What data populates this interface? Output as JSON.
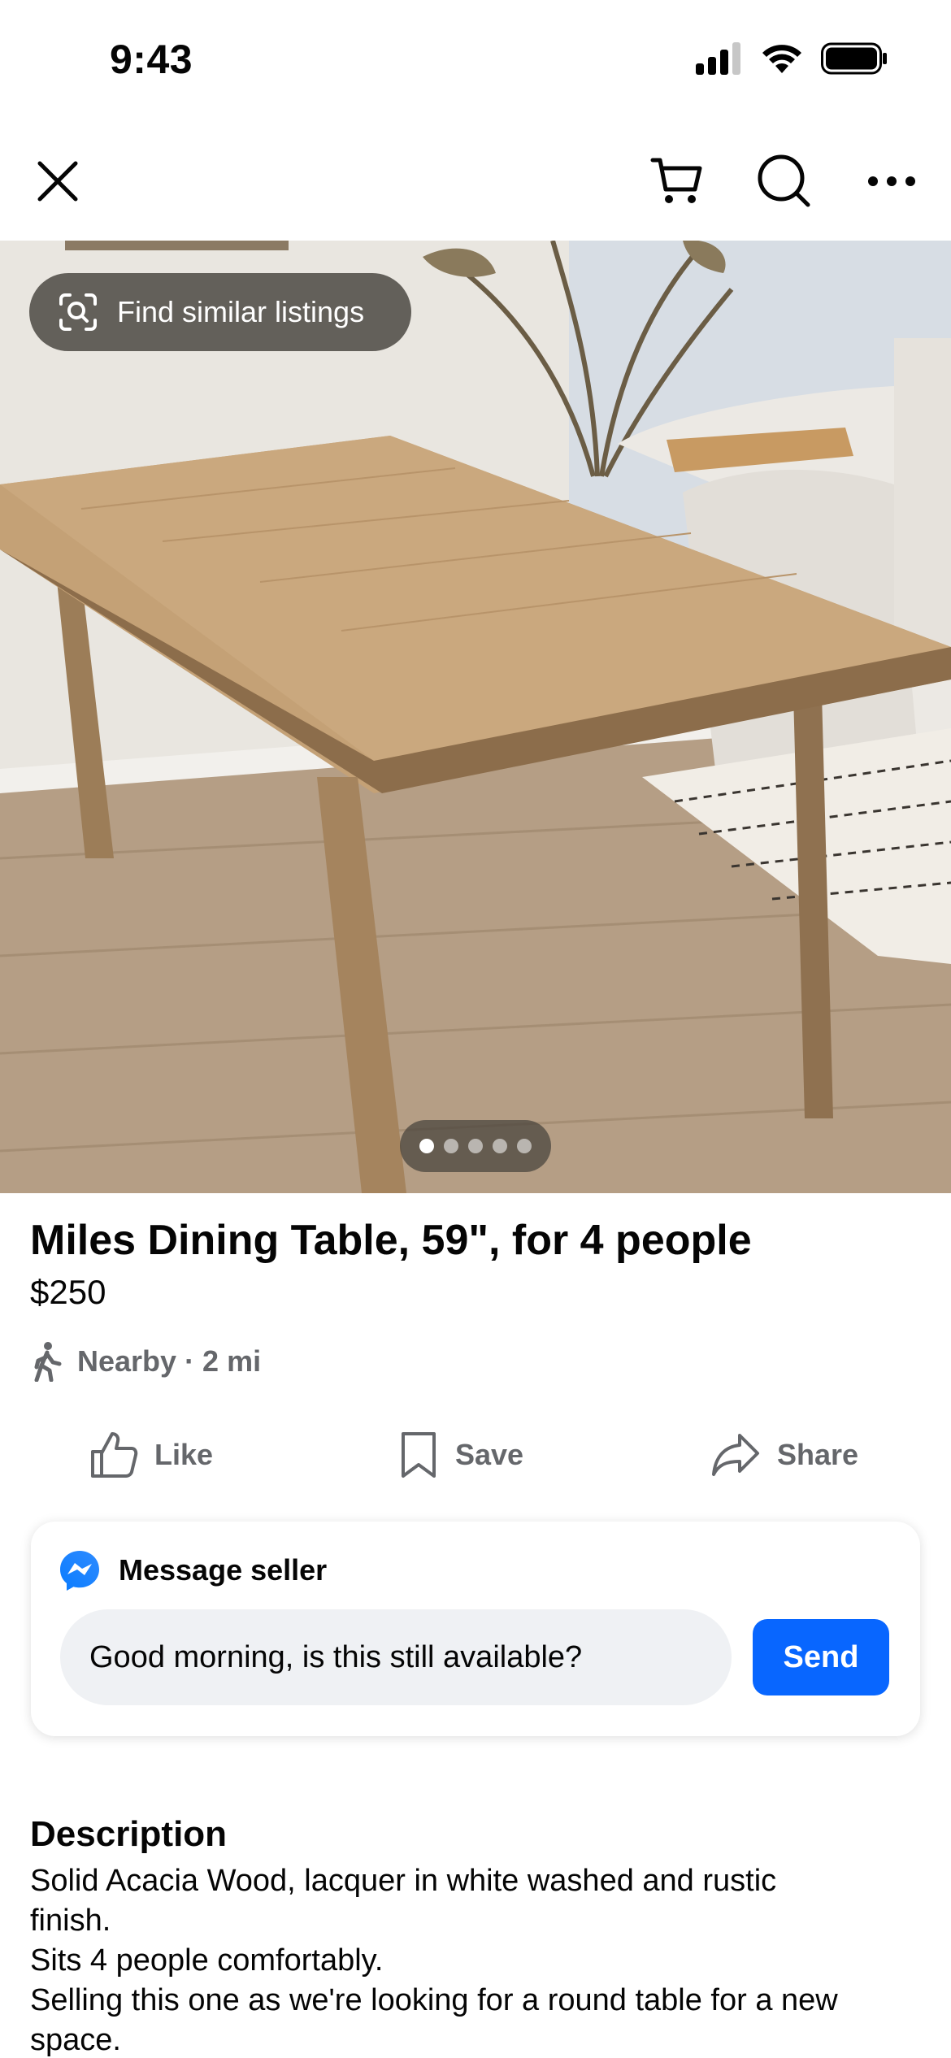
{
  "status_bar": {
    "time": "9:43"
  },
  "nav": {
    "close_icon": "close-icon",
    "cart_icon": "cart-icon",
    "search_icon": "search-icon",
    "more_icon": "more-icon"
  },
  "photo": {
    "find_similar_label": "Find similar listings",
    "image_count": 5,
    "active_index": 0
  },
  "listing": {
    "title": "Miles Dining Table, 59\", for 4 people",
    "price": "$250",
    "location": "Nearby · 2 mi"
  },
  "actions": {
    "like": "Like",
    "save": "Save",
    "share": "Share"
  },
  "message": {
    "header": "Message seller",
    "input_value": "Good morning, is this still available?",
    "send_label": "Send"
  },
  "description": {
    "heading": "Description",
    "lines": [
      "Solid Acacia Wood, lacquer in white washed and rustic",
      "finish.",
      "Sits 4 people comfortably.",
      "Selling this one as we're looking for a round table for a new",
      "space."
    ]
  },
  "colors": {
    "accent": "#0866ff",
    "secondary_text": "#65676b",
    "input_bg": "#eff1f4"
  }
}
